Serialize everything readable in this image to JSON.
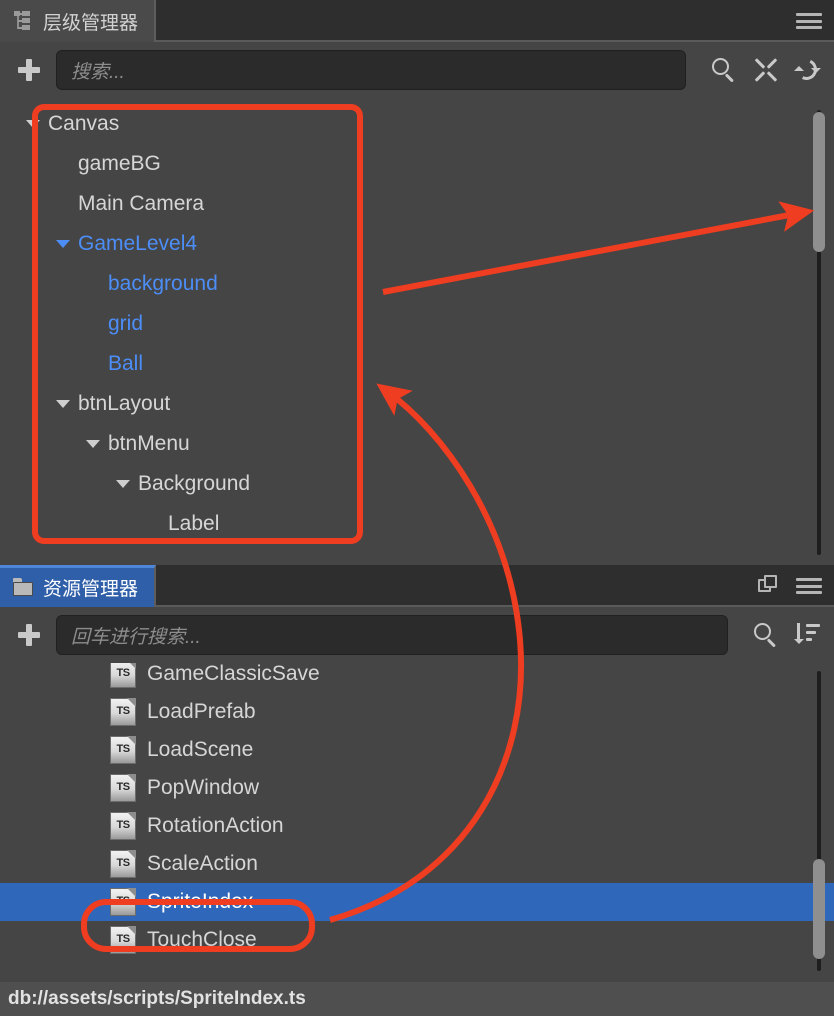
{
  "colors": {
    "panel_bg": "#454545",
    "tabbar_bg": "#2e2e2e",
    "tab_active_blue": "#2f5fa8",
    "selection_blue": "#2f67ba",
    "tree_blue_text": "#4c8df6",
    "annotation_red": "#ee3d20",
    "input_bg": "#2b2b2b",
    "status_bg": "#4f4f4f"
  },
  "hierarchy_panel": {
    "tab": {
      "label": "层级管理器",
      "icon": "hierarchy-tree-icon",
      "active": true
    },
    "menu_icon": "hamburger-menu-icon",
    "toolbar": {
      "add_icon": "plus-icon",
      "search_placeholder": "搜索...",
      "search_value": "",
      "icons": [
        "search-icon",
        "collapse-all-icon",
        "refresh-icon"
      ]
    },
    "tree": [
      {
        "label": "Canvas",
        "depth": 0,
        "expanded": true,
        "has_caret": true,
        "highlight": false
      },
      {
        "label": "gameBG",
        "depth": 1,
        "expanded": false,
        "has_caret": false,
        "highlight": false
      },
      {
        "label": "Main Camera",
        "depth": 1,
        "expanded": false,
        "has_caret": false,
        "highlight": false
      },
      {
        "label": "GameLevel4",
        "depth": 1,
        "expanded": true,
        "has_caret": true,
        "highlight": true
      },
      {
        "label": "background",
        "depth": 2,
        "expanded": false,
        "has_caret": false,
        "highlight": true
      },
      {
        "label": "grid",
        "depth": 2,
        "expanded": false,
        "has_caret": false,
        "highlight": true
      },
      {
        "label": "Ball",
        "depth": 2,
        "expanded": false,
        "has_caret": false,
        "highlight": true
      },
      {
        "label": "btnLayout",
        "depth": 1,
        "expanded": true,
        "has_caret": true,
        "highlight": false
      },
      {
        "label": "btnMenu",
        "depth": 2,
        "expanded": true,
        "has_caret": true,
        "highlight": false
      },
      {
        "label": "Background",
        "depth": 3,
        "expanded": true,
        "has_caret": true,
        "highlight": false
      },
      {
        "label": "Label",
        "depth": 4,
        "expanded": false,
        "has_caret": false,
        "highlight": false
      }
    ]
  },
  "assets_panel": {
    "tab": {
      "label": "资源管理器",
      "icon": "folder-icon",
      "active": true
    },
    "header_icons": [
      "duplicate-icon",
      "hamburger-menu-icon"
    ],
    "toolbar": {
      "add_icon": "plus-icon",
      "search_placeholder": "回车进行搜索...",
      "search_value": "",
      "icons": [
        "search-icon",
        "sort-descending-icon"
      ]
    },
    "files": [
      {
        "name": "GameClassicSave",
        "type": "TS",
        "selected": false
      },
      {
        "name": "LoadPrefab",
        "type": "TS",
        "selected": false
      },
      {
        "name": "LoadScene",
        "type": "TS",
        "selected": false
      },
      {
        "name": "PopWindow",
        "type": "TS",
        "selected": false
      },
      {
        "name": "RotationAction",
        "type": "TS",
        "selected": false
      },
      {
        "name": "ScaleAction",
        "type": "TS",
        "selected": false
      },
      {
        "name": "SpriteIndex",
        "type": "TS",
        "selected": true
      },
      {
        "name": "TouchClose",
        "type": "TS",
        "selected": false
      }
    ]
  },
  "status_bar": {
    "path": "db://assets/scripts/SpriteIndex.ts"
  },
  "annotations": {
    "tree_box": "red-rectangle-highlight-hierarchy",
    "file_box": "red-rectangle-highlight-spriteindex",
    "arrow_to_scrollbar": "red-straight-arrow",
    "arrow_file_to_tree": "red-curved-arrow"
  }
}
